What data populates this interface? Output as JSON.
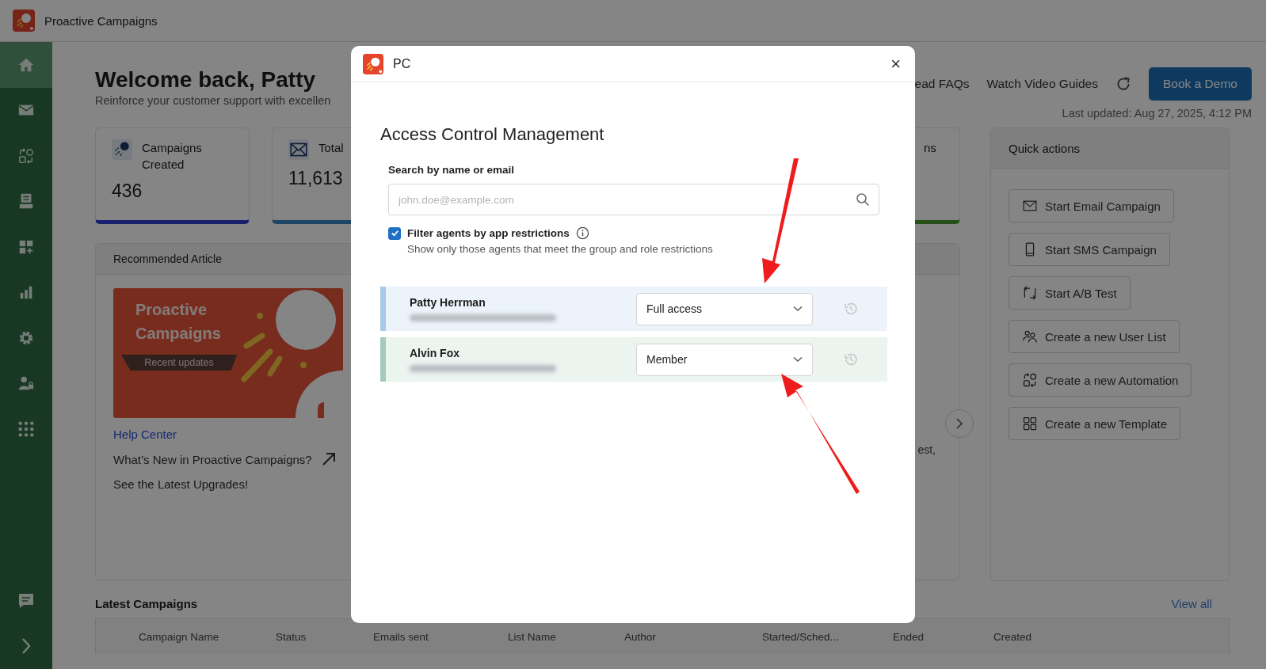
{
  "app": {
    "title": "Proactive Campaigns"
  },
  "sidebar": {
    "items": [
      {
        "kind": "home",
        "selected": true
      },
      {
        "kind": "mail",
        "selected": false
      },
      {
        "kind": "automation",
        "selected": false
      },
      {
        "kind": "stack",
        "selected": false
      },
      {
        "kind": "widgets",
        "selected": false
      },
      {
        "kind": "chart",
        "selected": false
      },
      {
        "kind": "gear",
        "selected": false
      },
      {
        "kind": "user-lock",
        "selected": false
      },
      {
        "kind": "apps",
        "selected": false
      }
    ],
    "bottom": [
      {
        "kind": "chat"
      },
      {
        "kind": "expand"
      }
    ]
  },
  "header": {
    "title": "Welcome back, Patty",
    "subtitle": "Reinforce your customer support with excellen",
    "links": [
      "ead FAQs",
      "Watch Video Guides"
    ],
    "primary_button": "Book a Demo",
    "last_updated": "Last updated: Aug 27, 2025, 4:12 PM"
  },
  "stats": [
    {
      "kind": "campaigns",
      "label": "Campaigns Created",
      "value": "436"
    },
    {
      "kind": "emails",
      "label": "Total",
      "value": "11,613"
    },
    {
      "kind": "hidden",
      "label": "ns"
    }
  ],
  "recommended": {
    "title": "Recommended Article",
    "banner": {
      "title": "Proactive Campaigns",
      "tag": "Recent updates"
    },
    "category": "Help Center",
    "links": [
      {
        "text": "What’s New in Proactive Campaigns?",
        "external": true
      },
      {
        "text": "See the Latest Upgrades!",
        "external": false
      }
    ],
    "side_text": "est,"
  },
  "quick_actions": {
    "title": "Quick actions",
    "items": [
      {
        "kind": "email",
        "label": "Start Email Campaign"
      },
      {
        "kind": "sms",
        "label": "Start SMS Campaign"
      },
      {
        "kind": "ab",
        "label": "Start A/B Test"
      },
      {
        "kind": "users",
        "label": "Create a new User List"
      },
      {
        "kind": "automation",
        "label": "Create a new Automation"
      },
      {
        "kind": "template",
        "label": "Create a new Template"
      }
    ]
  },
  "latest": {
    "title": "Latest Campaigns",
    "view_all": "View all",
    "columns": [
      "Campaign Name",
      "Status",
      "Emails sent",
      "List Name",
      "Author",
      "Started/Sched...",
      "Ended",
      "Created"
    ]
  },
  "modal": {
    "title": "PC",
    "close": "×",
    "heading": "Access Control Management",
    "search": {
      "label": "Search by name or email",
      "placeholder": "john.doe@example.com"
    },
    "filter": {
      "label": "Filter agents by app restrictions",
      "hint": "Show only those agents that meet the group and role restrictions",
      "checked": true
    },
    "agents": [
      {
        "name": "Patty Herrman",
        "role": "Full access",
        "color": "#a9c9e8"
      },
      {
        "name": "Alvin Fox",
        "role": "Member",
        "color": "#a3cbb8"
      }
    ]
  },
  "annotations": [
    {
      "kind": "arrow"
    },
    {
      "kind": "arrow"
    }
  ]
}
